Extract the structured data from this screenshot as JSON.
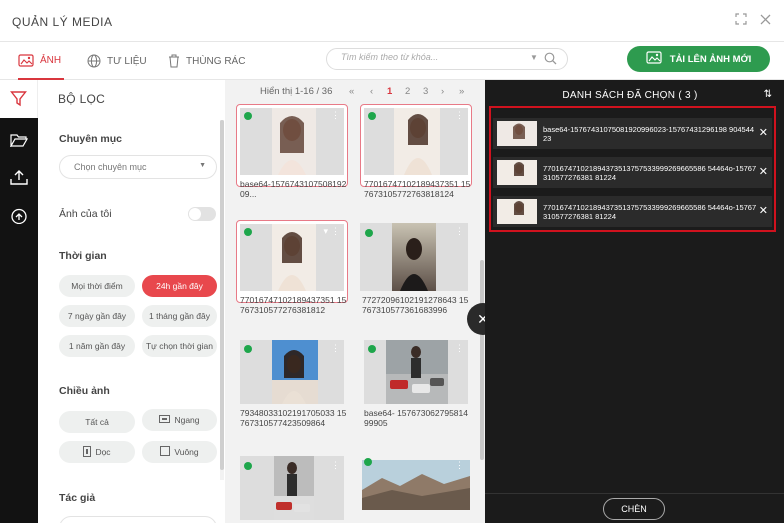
{
  "window": {
    "title": "QUẢN LÝ MEDIA"
  },
  "tabs": [
    {
      "label": "ẢNH",
      "icon": "image-icon",
      "active": true
    },
    {
      "label": "TƯ LIỆU",
      "icon": "globe-icon",
      "active": false
    },
    {
      "label": "THÙNG RÁC",
      "icon": "trash-icon",
      "active": false
    }
  ],
  "search": {
    "placeholder": "Tìm kiếm theo từ khóa..."
  },
  "upload_button": {
    "label": "TẢI LÊN ẢNH MỚI",
    "color": "#2e9b4f"
  },
  "filter": {
    "title": "BỘ LỌC",
    "category_label": "Chuyên mục",
    "category_placeholder": "Chọn chuyên mục",
    "my_images_label": "Ảnh của tôi",
    "time_label": "Thời gian",
    "time_options": [
      "Mọi thời điểm",
      "24h gần đây",
      "7 ngày gần đây",
      "1 tháng gần đây",
      "1 năm gần đây",
      "Tự chọn thời gian"
    ],
    "time_selected": "24h gần đây",
    "orientation_label": "Chiều ảnh",
    "orientation_options": [
      "Tất cả",
      "Ngang",
      "Dọc",
      "Vuông"
    ],
    "author_label": "Tác giả"
  },
  "pagination": {
    "summary": "Hiển thị 1-16 / 36",
    "pages": [
      "1",
      "2",
      "3"
    ],
    "current": "1"
  },
  "media": [
    {
      "name": "base64-157674310750819209...",
      "selected": true
    },
    {
      "name": "77016747102189437351 157673105772763818124",
      "selected": true
    },
    {
      "name": "77016747102189437351 15767310577276381812",
      "selected": true
    },
    {
      "name": "77272096102191278643 15767310577361683996",
      "selected": false
    },
    {
      "name": "79348033102191705033 15767310577423509864",
      "selected": false
    },
    {
      "name": "base64- 15767306279581499905",
      "selected": false
    },
    {
      "name": "",
      "selected": false
    },
    {
      "name": "",
      "selected": false
    }
  ],
  "selected_panel": {
    "title": "DANH SÁCH ĐÃ CHỌN ( 3 )",
    "items": [
      "base64-15767431075081920996023-15767431296198 90454423",
      "770167471021894373513757533999269665586 54464o-15767310577276381 81224",
      "770167471021894373513757533999269665586 54464o-15767310577276381 81224"
    ],
    "insert_label": "CHÈN",
    "highlight_color": "#d0121e"
  },
  "colors": {
    "accent": "#d9363e",
    "chip_active": "#e8484d",
    "status_dot": "#1ea64b"
  }
}
